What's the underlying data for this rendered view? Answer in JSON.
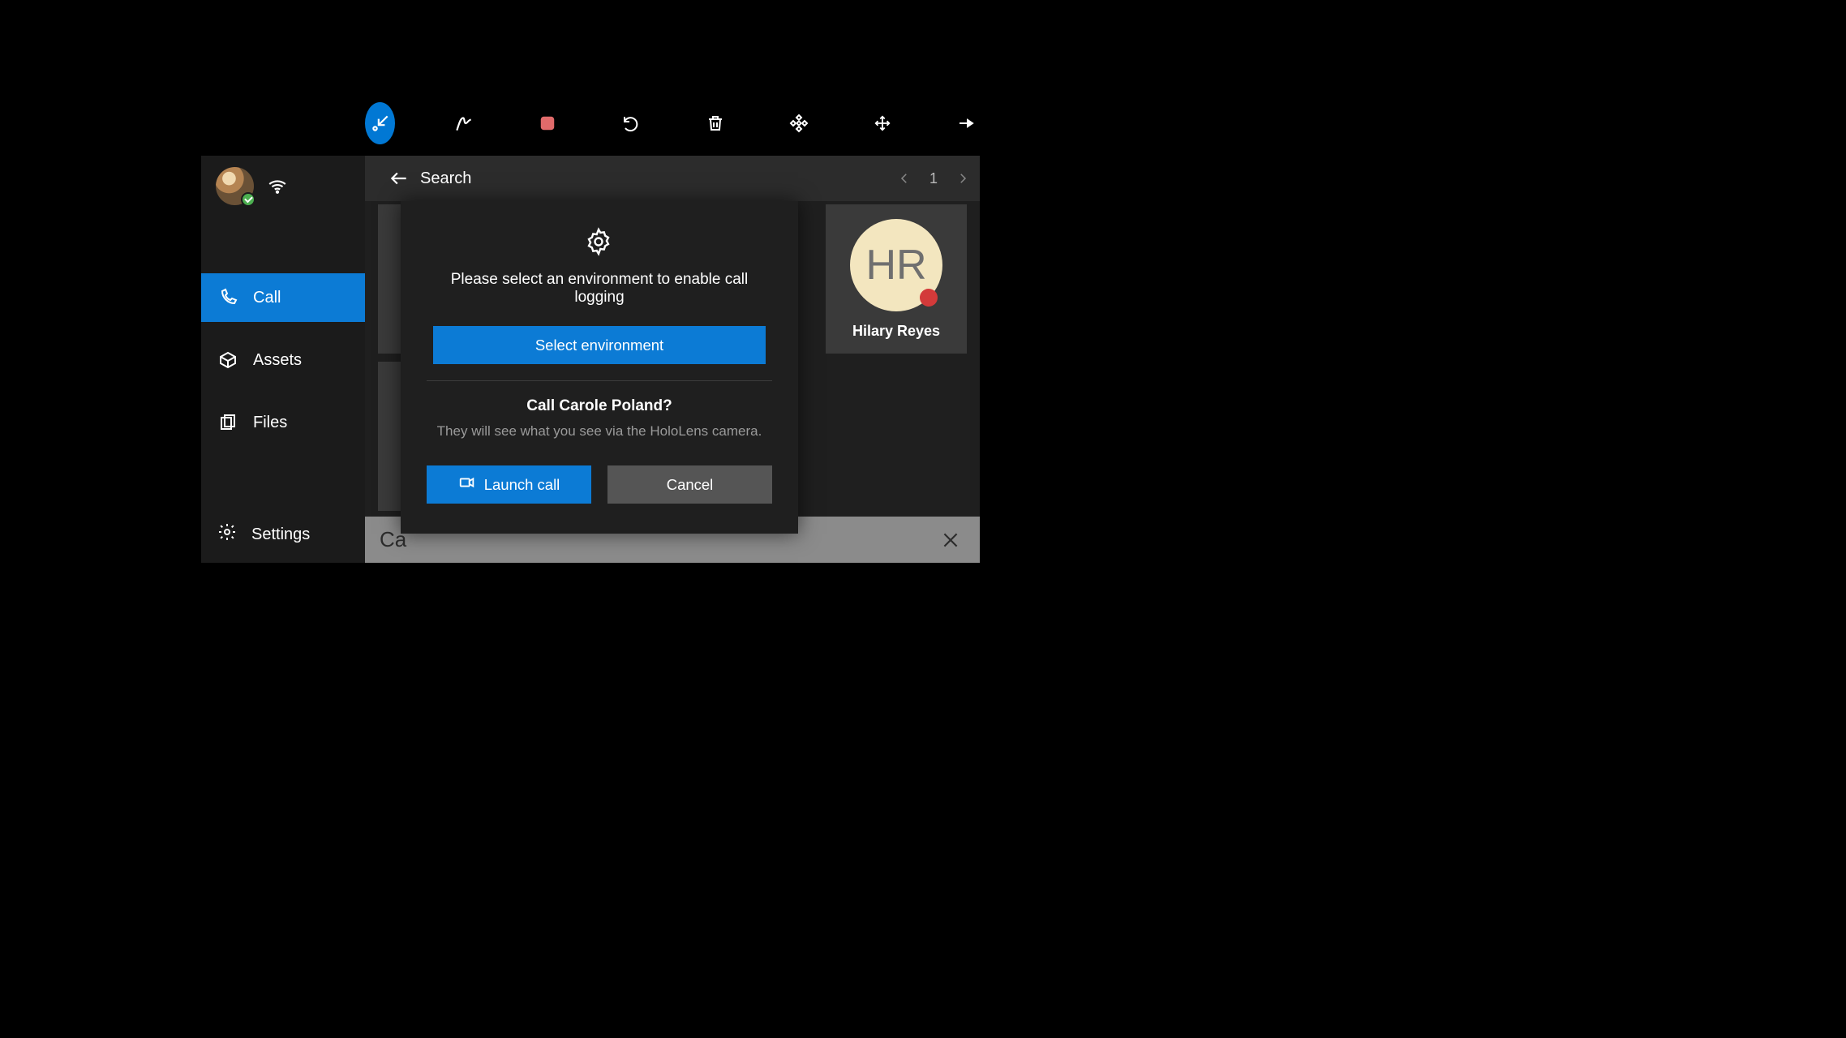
{
  "toolbar": {
    "icons": [
      "arrow-inward",
      "ink-pen",
      "stop-record",
      "undo",
      "trash",
      "focus-target",
      "move",
      "pin"
    ]
  },
  "sidebar": {
    "nav": [
      {
        "label": "Call",
        "icon": "phone"
      },
      {
        "label": "Assets",
        "icon": "package"
      },
      {
        "label": "Files",
        "icon": "files"
      }
    ],
    "settings_label": "Settings"
  },
  "header": {
    "title": "Search",
    "page_number": "1"
  },
  "contact_card": {
    "initials": "HR",
    "name": "Hilary Reyes"
  },
  "search": {
    "value": "Ca"
  },
  "modal": {
    "env_message": "Please select an environment to enable call logging",
    "select_env_label": "Select environment",
    "call_question": "Call Carole Poland?",
    "call_description": "They will see what you see via the HoloLens camera.",
    "launch_label": "Launch call",
    "cancel_label": "Cancel"
  }
}
